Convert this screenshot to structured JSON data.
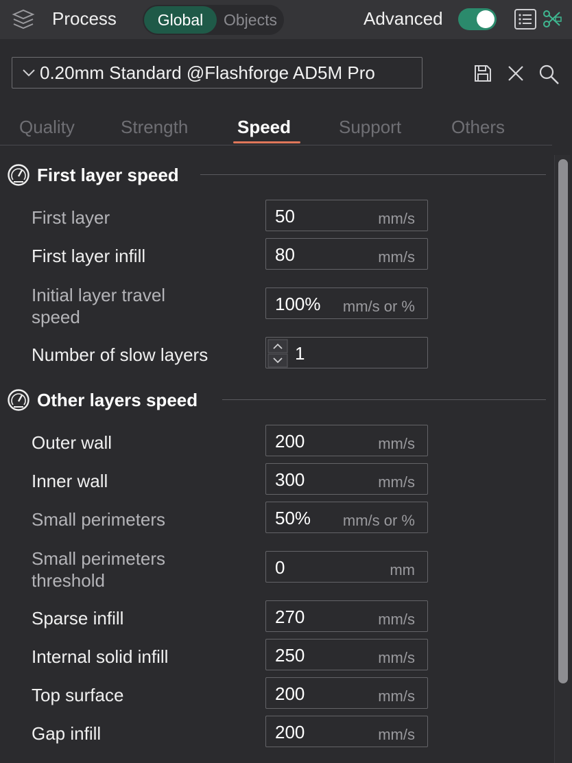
{
  "header": {
    "title": "Process",
    "mode_options": [
      "Global",
      "Objects"
    ],
    "mode_selected": "Global",
    "advanced_label": "Advanced",
    "advanced_on": true
  },
  "preset": {
    "name": "0.20mm Standard @Flashforge AD5M Pro"
  },
  "tabs": [
    {
      "label": "Quality",
      "active": false
    },
    {
      "label": "Strength",
      "active": false
    },
    {
      "label": "Speed",
      "active": true
    },
    {
      "label": "Support",
      "active": false
    },
    {
      "label": "Others",
      "active": false
    }
  ],
  "sections": [
    {
      "title": "First layer speed",
      "rows": [
        {
          "label": "First layer",
          "value": "50",
          "unit": "mm/s"
        },
        {
          "label": "First layer infill",
          "value": "80",
          "unit": "mm/s"
        },
        {
          "label": "Initial layer travel speed",
          "value": "100%",
          "unit": "mm/s or %"
        },
        {
          "label": "Number of slow layers",
          "value": "1",
          "unit": ""
        }
      ]
    },
    {
      "title": "Other layers speed",
      "rows": [
        {
          "label": "Outer wall",
          "value": "200",
          "unit": "mm/s"
        },
        {
          "label": "Inner wall",
          "value": "300",
          "unit": "mm/s"
        },
        {
          "label": "Small perimeters",
          "value": "50%",
          "unit": "mm/s or %"
        },
        {
          "label": "Small perimeters threshold",
          "value": "0",
          "unit": "mm"
        },
        {
          "label": "Sparse infill",
          "value": "270",
          "unit": "mm/s"
        },
        {
          "label": "Internal solid infill",
          "value": "250",
          "unit": "mm/s"
        },
        {
          "label": "Top surface",
          "value": "200",
          "unit": "mm/s"
        },
        {
          "label": "Gap infill",
          "value": "200",
          "unit": "mm/s"
        }
      ]
    }
  ],
  "icons": [
    "layers-icon",
    "list-icon",
    "scissors-icon",
    "chevron-down-icon",
    "save-icon",
    "close-icon",
    "search-icon",
    "gauge-icon",
    "stepper-up-icon",
    "stepper-down-icon"
  ],
  "colors": {
    "accent": "#2b8a6c",
    "tab_underline": "#e0775a",
    "background": "#2b2b2e"
  }
}
